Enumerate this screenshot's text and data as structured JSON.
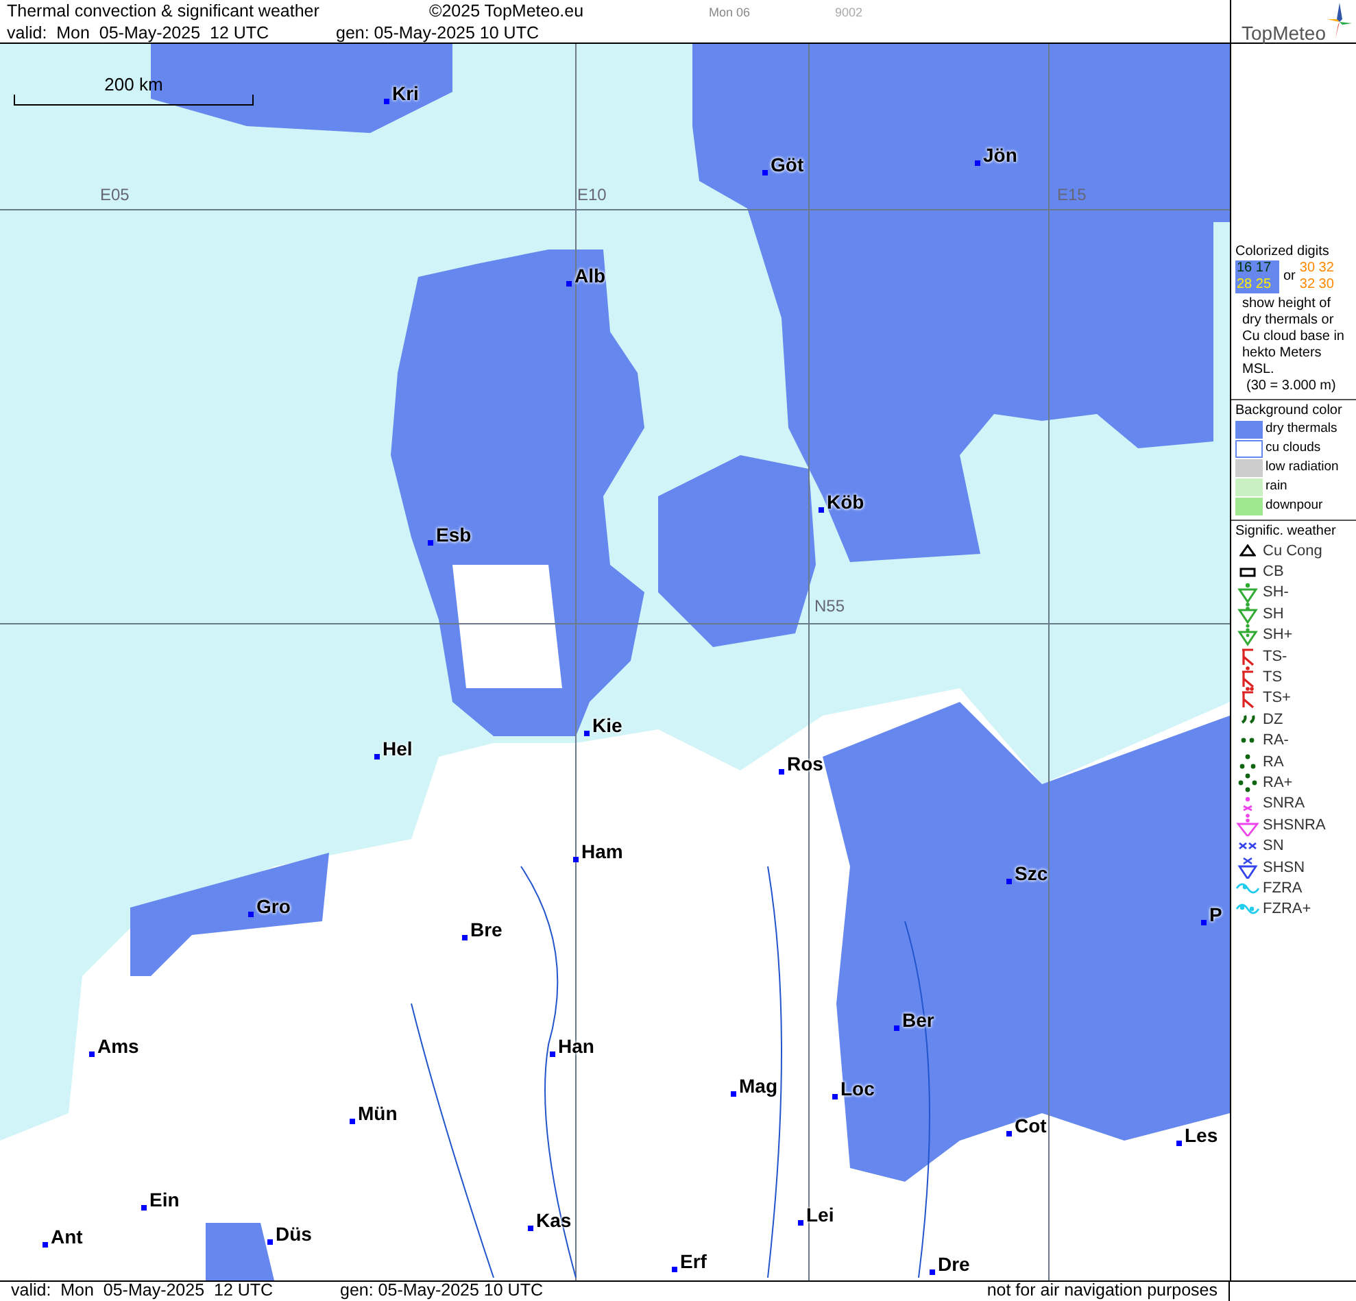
{
  "header": {
    "title": "Thermal convection & significant weather",
    "copyright": "©2025 TopMeteo.eu",
    "day_tab": "Mon 06",
    "code": "9002",
    "valid": "valid:  Mon  05-May-2025  12 UTC",
    "gen": "gen: 05-May-2025 10 UTC",
    "logo": "TopMeteo"
  },
  "map": {
    "scale": "200 km",
    "grid_labels": [
      "E05",
      "E10",
      "E15",
      "N55"
    ],
    "cities": [
      {
        "name": "Kri"
      },
      {
        "name": "Göt"
      },
      {
        "name": "Jön"
      },
      {
        "name": "Alb"
      },
      {
        "name": "Esb"
      },
      {
        "name": "Köb"
      },
      {
        "name": "Kie"
      },
      {
        "name": "Hel"
      },
      {
        "name": "Ros"
      },
      {
        "name": "Ham"
      },
      {
        "name": "Szc"
      },
      {
        "name": "Gro"
      },
      {
        "name": "Bre"
      },
      {
        "name": "Ber"
      },
      {
        "name": "Ams"
      },
      {
        "name": "Han"
      },
      {
        "name": "Mag"
      },
      {
        "name": "Loc"
      },
      {
        "name": "Mün"
      },
      {
        "name": "Cot"
      },
      {
        "name": "Les"
      },
      {
        "name": "Ein"
      },
      {
        "name": "Lei"
      },
      {
        "name": "Kas"
      },
      {
        "name": "Ant"
      },
      {
        "name": "Düs"
      },
      {
        "name": "Dre"
      },
      {
        "name": "Erf"
      },
      {
        "name": "P"
      }
    ]
  },
  "legend": {
    "digits_title": "Colorized digits",
    "samples": [
      {
        "text": "16 17",
        "color": "#003300"
      },
      {
        "text": "28 25",
        "color": "#ffee00"
      }
    ],
    "or": "or",
    "samples_alt": [
      {
        "text": "30 32",
        "color": "#ff8800"
      },
      {
        "text": "32 30",
        "color": "#ff8800"
      }
    ],
    "digits_note": "show height of dry thermals or Cu cloud base in hekto Meters MSL.",
    "digits_example": "(30 = 3.000 m)",
    "background_title": "Background color",
    "backgrounds": [
      {
        "label": "dry thermals",
        "color": "#6688ee"
      },
      {
        "label": "cu clouds",
        "color": "#ffffff"
      },
      {
        "label": "low radiation",
        "color": "#cccccc"
      },
      {
        "label": "rain",
        "color": "#c8f0c0"
      },
      {
        "label": "downpour",
        "color": "#a0e890"
      }
    ],
    "weather_title": "Signific. weather",
    "weather": [
      {
        "kind": "cucong",
        "label": "Cu Cong",
        "color": "#000000"
      },
      {
        "kind": "cb",
        "label": "CB",
        "color": "#000000"
      },
      {
        "kind": "shower1",
        "label": "SH-",
        "color": "#33aa33"
      },
      {
        "kind": "shower2",
        "label": "SH",
        "color": "#33aa33"
      },
      {
        "kind": "shower3",
        "label": "SH+",
        "color": "#33aa33"
      },
      {
        "kind": "ts1",
        "label": "TS-",
        "color": "#dd2222"
      },
      {
        "kind": "ts2",
        "label": "TS",
        "color": "#dd2222"
      },
      {
        "kind": "ts3",
        "label": "TS+",
        "color": "#dd2222"
      },
      {
        "kind": "drizzle",
        "label": "DZ",
        "color": "#116611"
      },
      {
        "kind": "rain1",
        "label": "RA-",
        "color": "#116611"
      },
      {
        "kind": "rain2",
        "label": "RA",
        "color": "#116611"
      },
      {
        "kind": "rain3",
        "label": "RA+",
        "color": "#116611"
      },
      {
        "kind": "snra",
        "label": "SNRA",
        "color": "#ee44ee"
      },
      {
        "kind": "shsnra",
        "label": "SHSNRA",
        "color": "#ee44ee"
      },
      {
        "kind": "snow",
        "label": "SN",
        "color": "#3344ee"
      },
      {
        "kind": "shsn",
        "label": "SHSN",
        "color": "#3344ee"
      },
      {
        "kind": "fzra1",
        "label": "FZRA",
        "color": "#22ccee"
      },
      {
        "kind": "fzra2",
        "label": "FZRA+",
        "color": "#22ccee"
      }
    ]
  },
  "footer": {
    "valid": "valid:  Mon  05-May-2025  12 UTC",
    "gen": "gen: 05-May-2025 10 UTC",
    "note": "not for air navigation purposes"
  }
}
